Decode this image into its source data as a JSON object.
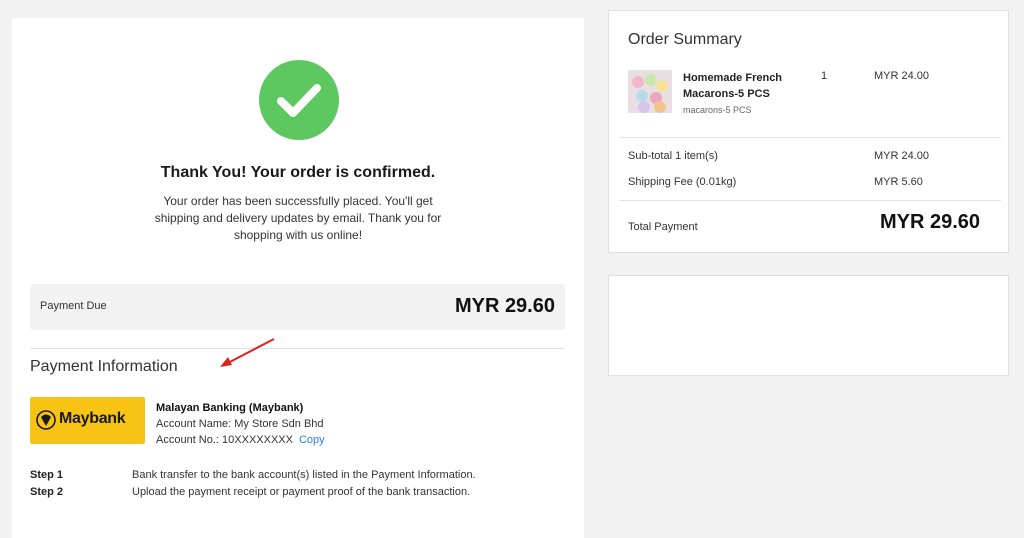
{
  "confirmation": {
    "title": "Thank You! Your order is confirmed.",
    "message": "Your order has been successfully placed. You'll get shipping and delivery updates by email. Thank you for shopping with us online!"
  },
  "payment_due": {
    "label": "Payment Due",
    "amount": "MYR 29.60"
  },
  "payment_info": {
    "title": "Payment Information",
    "bank_logo_text": "Maybank",
    "bank_name": "Malayan Banking (Maybank)",
    "account_name": "Account Name: My Store Sdn Bhd",
    "account_no": "Account No.: 10XXXXXXXX",
    "copy_label": "Copy"
  },
  "steps": [
    {
      "label": "Step 1",
      "text": "Bank transfer to the bank account(s) listed in the Payment Information."
    },
    {
      "label": "Step 2",
      "text": "Upload the payment receipt or payment proof of the bank transaction."
    }
  ],
  "order_summary": {
    "title": "Order Summary",
    "product": {
      "name": "Homemade French Macarons-5 PCS",
      "variant": "macarons-5 PCS",
      "qty": "1",
      "price": "MYR 24.00"
    },
    "subtotal_label": "Sub-total 1 item(s)",
    "subtotal_value": "MYR 24.00",
    "shipping_label": "Shipping Fee (0.01kg)",
    "shipping_value": "MYR 5.60",
    "total_label": "Total Payment",
    "total_value": "MYR 29.60"
  },
  "colors": {
    "success": "#5dc85f",
    "maybank_yellow": "#f7c416",
    "link": "#2b7de9",
    "annotation_arrow": "#e0201b"
  }
}
